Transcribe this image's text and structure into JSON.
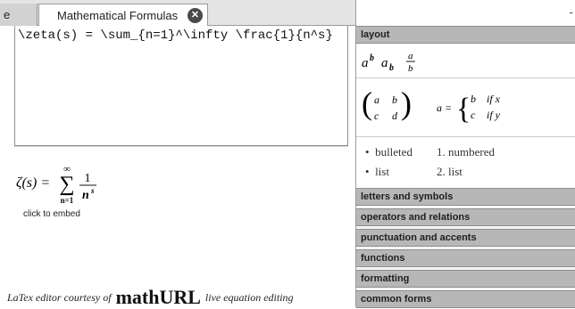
{
  "tabs": {
    "partial_label": "e",
    "active_title": "Mathematical Formulas",
    "close_glyph": "✕",
    "right_mark": "-"
  },
  "editor": {
    "latex": "\\zeta(s) = \\sum_{n=1}^\\infty \\frac{1}{n^s}"
  },
  "preview": {
    "lhs": "ζ(s) =",
    "sum_upper": "∞",
    "sum_lower": "n=1",
    "numerator": "1",
    "denominator_base": "n",
    "denominator_exp": "s",
    "embed_label": "click to embed"
  },
  "credit": {
    "prefix": "LaTex editor courtesy of",
    "brand": "mathURL",
    "suffix": "live equation editing"
  },
  "panel": {
    "sections": [
      "layout",
      "letters and symbols",
      "operators and relations",
      "punctuation and accents",
      "functions",
      "formatting",
      "common forms"
    ],
    "layout": {
      "sup_base": "a",
      "sup_exp": "b",
      "sub_base": "a",
      "sub_idx": "b",
      "frac_num": "a",
      "frac_den": "b",
      "matrix": [
        "a",
        "b",
        "c",
        "d"
      ],
      "cases_lhs": "a =",
      "case1_val": "b",
      "case1_cond": "if x",
      "case2_val": "c",
      "case2_cond": "if y",
      "bullet1": "bulleted",
      "bullet2": "list",
      "num1_marker": "1.",
      "num1": "numbered",
      "num2_marker": "2.",
      "num2": "list"
    }
  },
  "colors": {
    "section_header_bg": "#b7b7b7",
    "tab_close_bg": "#4a4a4a"
  }
}
